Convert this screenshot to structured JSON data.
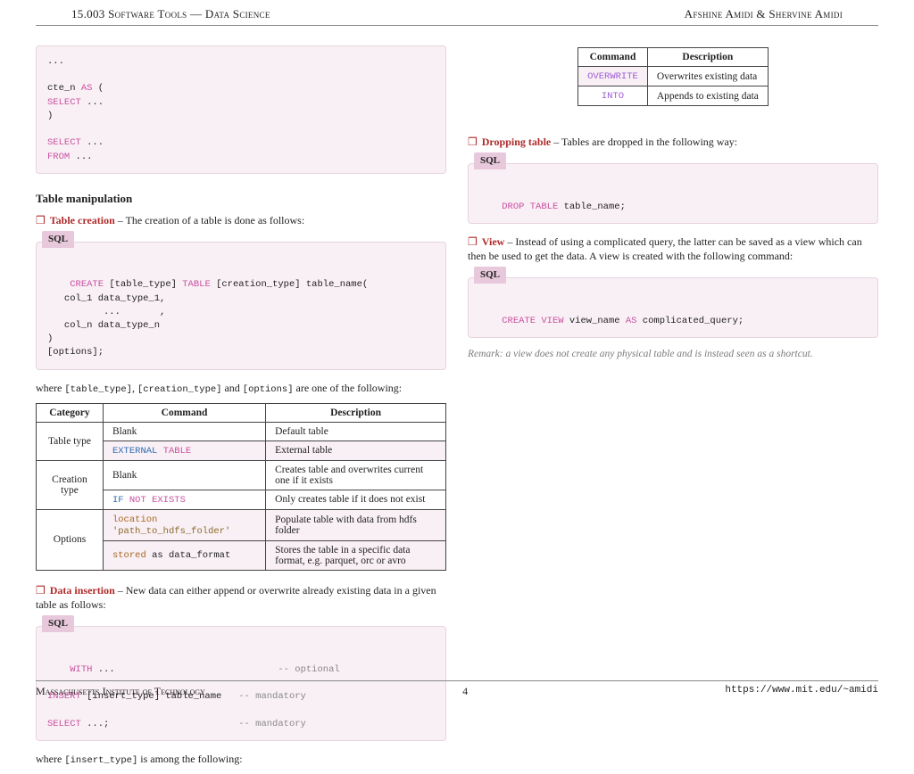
{
  "header": {
    "left": "15.003 Software Tools — Data Science",
    "right": "Afshine Amidi & Shervine Amidi"
  },
  "left": {
    "code1_lines": [
      {
        "t": "..."
      },
      {
        "t": ""
      },
      {
        "t": "cte_n ",
        "k": "AS",
        "t2": " ("
      },
      {
        "k": "SELECT",
        "t2": " ..."
      },
      {
        "t": ")"
      },
      {
        "t": ""
      },
      {
        "k": "SELECT",
        "t2": " ..."
      },
      {
        "k": "FROM",
        "t2": " ..."
      }
    ],
    "section1": "Table manipulation",
    "tc_head": "Table creation",
    "tc_text": " – The creation of a table is done as follows:",
    "code2_label": "SQL",
    "code2_lines": [
      {
        "k": "CREATE",
        "t1": " [table_type] ",
        "k2": "TABLE",
        "t2": " [creation_type] table_name("
      },
      {
        "t": "   col_1 data_type_1,"
      },
      {
        "t": "          ...       ,"
      },
      {
        "t": "   col_n data_type_n"
      },
      {
        "t": ")"
      },
      {
        "t": "[options];"
      }
    ],
    "where_line_pre": "where ",
    "where_c1": "[table_type]",
    "where_s1": ", ",
    "where_c2": "[creation_type]",
    "where_s2": " and ",
    "where_c3": "[options]",
    "where_post": " are one of the following:",
    "table1": {
      "headers": [
        "Category",
        "Command",
        "Description"
      ],
      "rows": [
        {
          "cat": "Table type",
          "rspan": 2,
          "cmd": "Blank",
          "cmd_mono": false,
          "desc": "Default table",
          "pink": false
        },
        {
          "cmd": "EXTERNAL TABLE",
          "cmd_mono": true,
          "cmd_blue": "EXTERNAL",
          "cmd_pink": "TABLE",
          "desc": "External table",
          "pink": true
        },
        {
          "cat": "Creation type",
          "rspan": 2,
          "cmd": "Blank",
          "cmd_mono": false,
          "desc": "Creates table and overwrites current one if it exists",
          "pink": false
        },
        {
          "cmd": "IF NOT EXISTS",
          "cmd_mono": true,
          "cmd_blue": "IF",
          "cmd_pink": "NOT EXISTS",
          "desc": "Only creates table if it does not exist",
          "pink": false
        },
        {
          "cat": "Options",
          "rspan": 2,
          "cmd": "location 'path_to_hdfs_folder'",
          "cmd_mono": true,
          "cmd_brown": "location",
          "cmd_str": "'path_to_hdfs_folder'",
          "desc": "Populate table with data from hdfs folder",
          "pink": true
        },
        {
          "cmd": "stored as data_format",
          "cmd_mono": true,
          "cmd_brown": "stored",
          "cmd_plain": " as data_format",
          "desc": "Stores the table in a specific data format, e.g. parquet, orc or avro",
          "pink": true
        }
      ]
    },
    "di_head": "Data insertion",
    "di_text": " – New data can either append or overwrite already existing data in a given table as follows:",
    "code3_label": "SQL",
    "code3_lines": [
      {
        "k": "WITH",
        "t": " ...",
        "pad": 30,
        "c": "-- optional"
      },
      {
        "blank": true
      },
      {
        "k": "INSERT",
        "t": " [insert_type] table_name",
        "pad": 4,
        "c": "-- mandatory"
      },
      {
        "blank": true
      },
      {
        "k": "SELECT",
        "t": " ...;",
        "pad": 24,
        "c": "-- mandatory"
      }
    ],
    "where2_pre": "where ",
    "where2_c": "[insert_type]",
    "where2_post": " is among the following:"
  },
  "right": {
    "table2": {
      "headers": [
        "Command",
        "Description"
      ],
      "rows": [
        {
          "cmd": "OVERWRITE",
          "desc": "Overwrites existing data",
          "violet": true,
          "pink": true
        },
        {
          "cmd": "INTO",
          "desc": "Appends to existing data",
          "violet": true,
          "pink": false
        }
      ]
    },
    "dt_head": "Dropping table",
    "dt_text": " – Tables are dropped in the following way:",
    "code4_label": "SQL",
    "code4_lines": [
      {
        "k": "DROP",
        "k2": "TABLE",
        "t": " table_name;"
      }
    ],
    "view_head": "View",
    "view_text": " – Instead of using a complicated query, the latter can be saved as a view which can then be used to get the data. A view is created with the following command:",
    "code5_label": "SQL",
    "code5_lines": [
      {
        "k": "CREATE",
        "k2": "VIEW",
        "t": " view_name ",
        "k3": "AS",
        "t2": " complicated_query;"
      }
    ],
    "remark": "Remark: a view does not create any physical table and is instead seen as a shortcut."
  },
  "footer": {
    "inst": "Massachusetts Institute of Technology",
    "page": "4",
    "url": "https://www.mit.edu/~amidi"
  }
}
